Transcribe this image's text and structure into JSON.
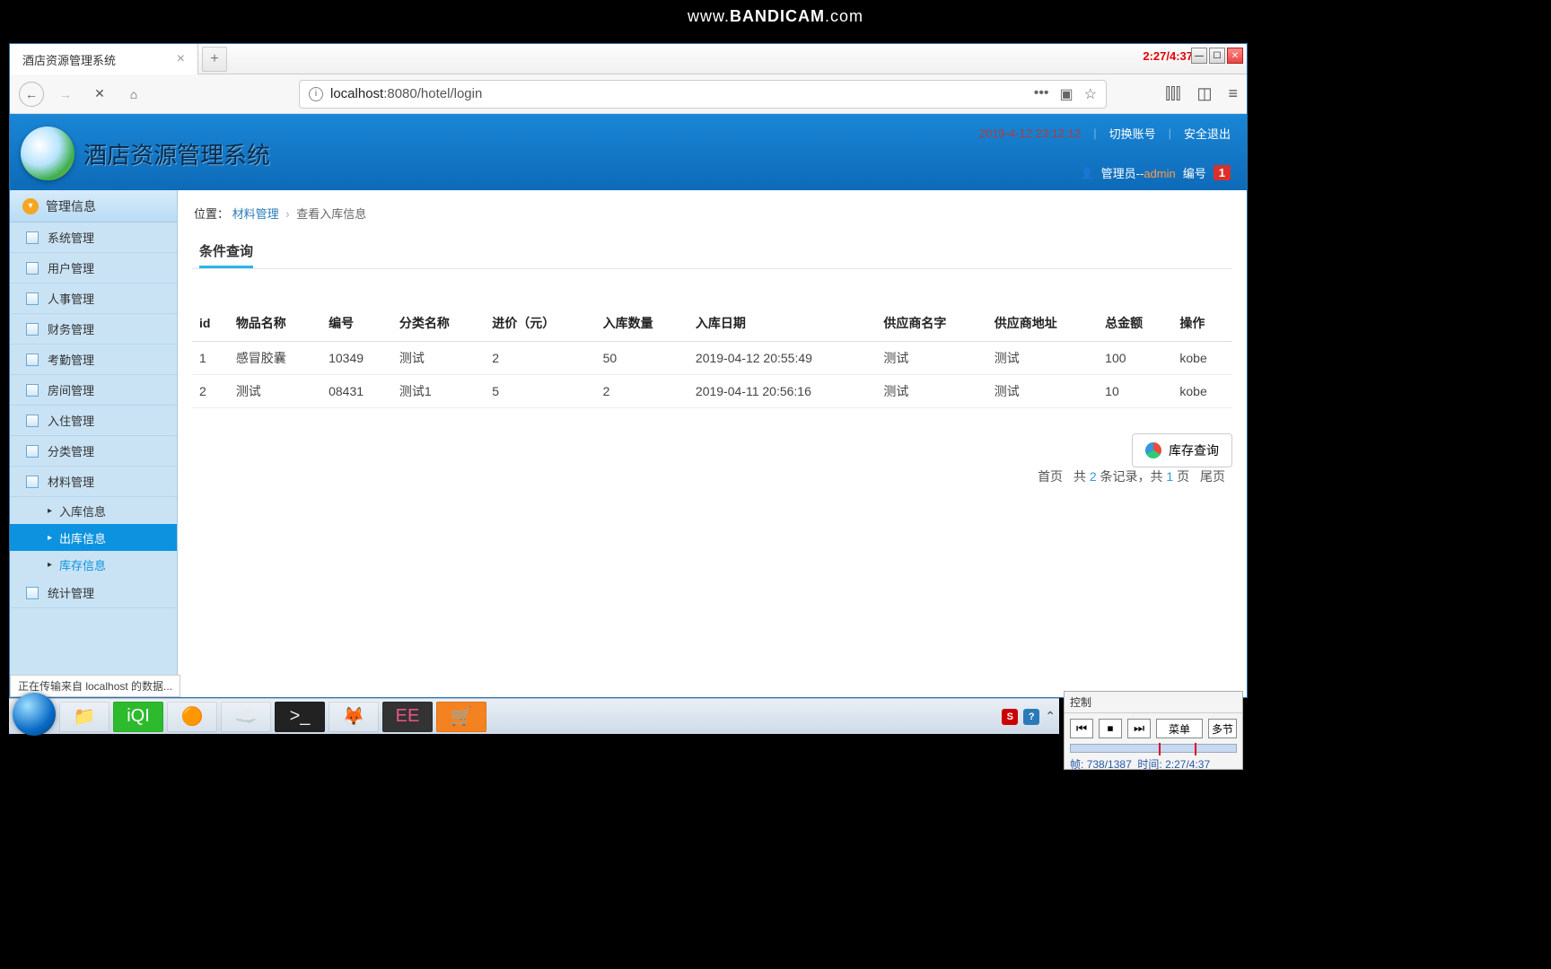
{
  "watermark": "www.BANDICAM.com",
  "browser": {
    "tab_title": "酒店资源管理系统",
    "timer": "2:27/4:37",
    "url_host": "localhost",
    "url_port": ":8080",
    "url_path": "/hotel/login",
    "status_text": "正在传输来自 localhost 的数据..."
  },
  "header": {
    "app_title": "酒店资源管理系统",
    "timestamp": "2019-4-12 23:12:12",
    "switch_account": "切换账号",
    "safe_exit": "安全退出",
    "role_prefix": "管理员--",
    "role_name": "admin",
    "id_label": "编号",
    "id_badge": "1"
  },
  "sidebar": {
    "category": "管理信息",
    "items": [
      "系统管理",
      "用户管理",
      "人事管理",
      "财务管理",
      "考勤管理",
      "房间管理",
      "入住管理",
      "分类管理",
      "材料管理"
    ],
    "sub": [
      "入库信息",
      "出库信息",
      "库存信息"
    ],
    "last": "统计管理"
  },
  "breadcrumb": {
    "label": "位置：",
    "p1": "材料管理",
    "p2": "查看入库信息"
  },
  "section": {
    "title": "条件查询",
    "stock_btn": "库存查询"
  },
  "table": {
    "cols": [
      "id",
      "物品名称",
      "编号",
      "分类名称",
      "进价（元）",
      "入库数量",
      "入库日期",
      "供应商名字",
      "供应商地址",
      "总金额",
      "操作"
    ],
    "rows": [
      [
        "1",
        "感冒胶囊",
        "10349",
        "测试",
        "2",
        "50",
        "2019-04-12 20:55:49",
        "测试",
        "测试",
        "100",
        "kobe"
      ],
      [
        "2",
        "测试",
        "08431",
        "测试1",
        "5",
        "2",
        "2019-04-11 20:56:16",
        "测试",
        "测试",
        "10",
        "kobe"
      ]
    ]
  },
  "pager": {
    "first": "首页",
    "pre": "共",
    "count": "2",
    "mid": "条记录，共",
    "pages": "1",
    "suf": "页",
    "last": "尾页"
  },
  "ctrl": {
    "title": "控制",
    "menu": "菜单",
    "multi": "多节",
    "info_frames_lbl": "帧:",
    "info_frames": "738/1387",
    "info_time_lbl": "时间:",
    "info_time": "2:27/4:37"
  }
}
